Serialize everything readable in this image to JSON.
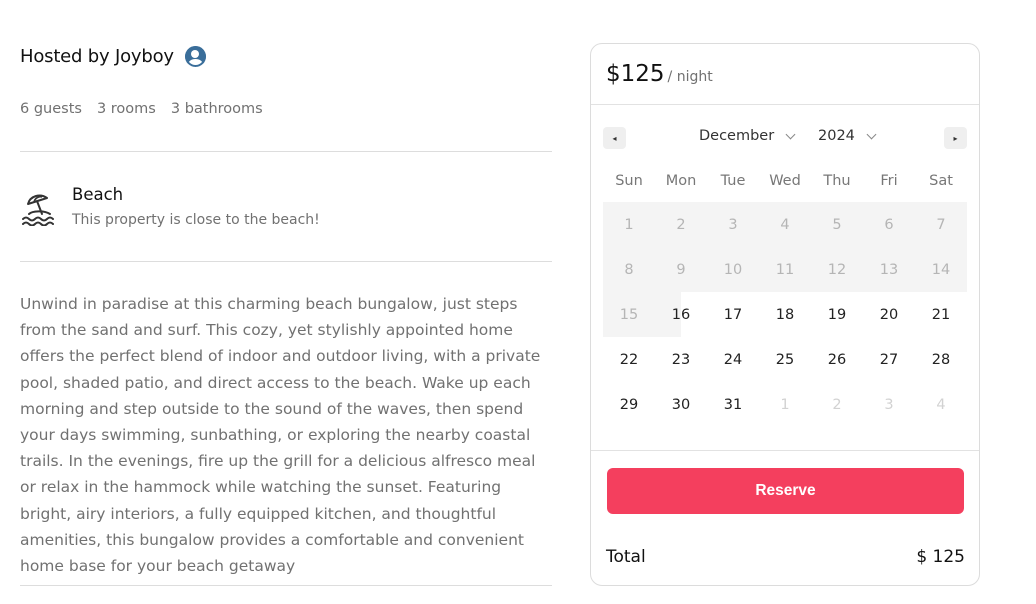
{
  "host": {
    "title": "Hosted by Joyboy"
  },
  "specs": {
    "guests": "6 guests",
    "rooms": "3 rooms",
    "bathrooms": "3 bathrooms"
  },
  "feature": {
    "icon": "beach-umbrella-icon",
    "title": "Beach",
    "subtitle": "This property is close to the beach!"
  },
  "description": "Unwind in paradise at this charming beach bungalow, just steps from the sand and surf. This cozy, yet stylishly appointed home offers the perfect blend of indoor and outdoor living, with a private pool, shaded patio, and direct access to the beach. Wake up each morning and step outside to the sound of the waves, then spend your days swimming, sunbathing, or exploring the nearby coastal trails. In the evenings, fire up the grill for a delicious alfresco meal or relax in the hammock while watching the sunset. Featuring bright, airy interiors, a fully equipped kitchen, and thoughtful amenities, this bungalow provides a comfortable and convenient home base for your beach getaway",
  "booking": {
    "price": "$125",
    "per_night": "/ night",
    "calendar": {
      "prev_icon": "◂",
      "next_icon": "▸",
      "month": "December",
      "year": "2024",
      "weekdays": [
        "Sun",
        "Mon",
        "Tue",
        "Wed",
        "Thu",
        "Fri",
        "Sat"
      ],
      "weeks": [
        [
          "1",
          "2",
          "3",
          "4",
          "5",
          "6",
          "7"
        ],
        [
          "8",
          "9",
          "10",
          "11",
          "12",
          "13",
          "14"
        ],
        [
          "15",
          "16",
          "17",
          "18",
          "19",
          "20",
          "21"
        ],
        [
          "22",
          "23",
          "24",
          "25",
          "26",
          "27",
          "28"
        ],
        [
          "29",
          "30",
          "31",
          "1",
          "2",
          "3",
          "4"
        ]
      ],
      "selected_day": "16"
    },
    "reserve_label": "Reserve",
    "total_label": "Total",
    "total_value": "$ 125"
  },
  "colors": {
    "accent": "#f43f5e",
    "selected_day": "#222222",
    "muted_text": "#717171"
  }
}
